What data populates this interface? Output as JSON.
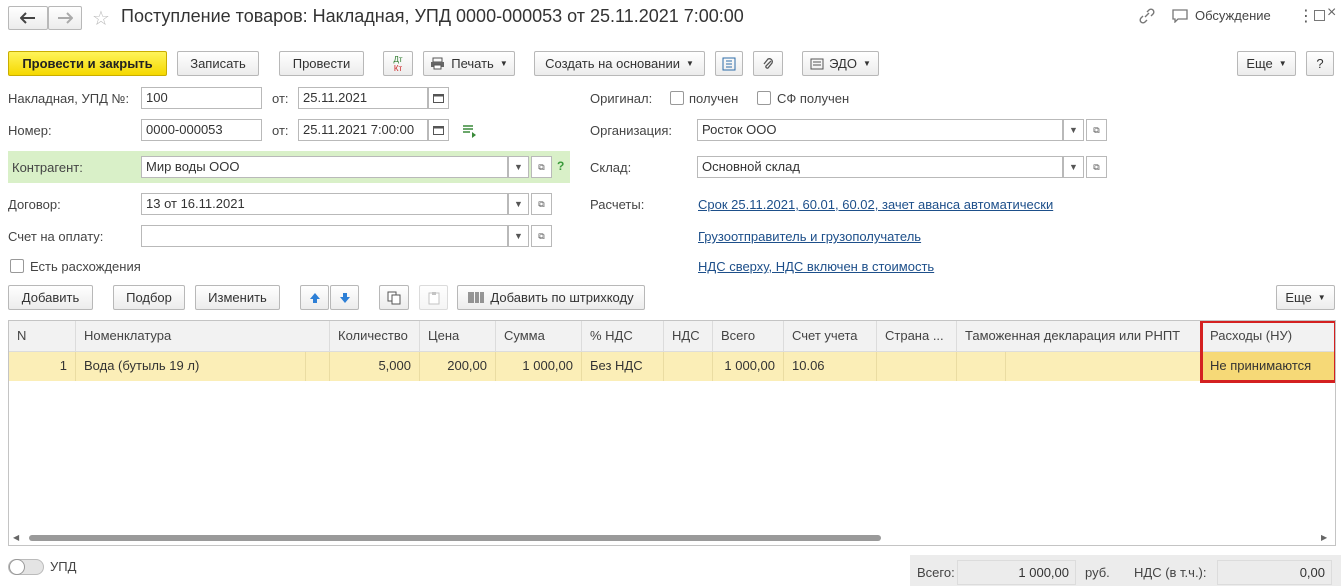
{
  "window": {
    "title": "Поступление товаров: Накладная, УПД 0000-000053 от 25.11.2021 7:00:00",
    "discussion": "Обсуждение"
  },
  "toolbar": {
    "post_close": "Провести и закрыть",
    "save": "Записать",
    "post": "Провести",
    "dtkt_top": "Дт",
    "dtkt_bottom": "Кт",
    "print": "Печать",
    "create_based": "Создать на основании",
    "edo": "ЭДО",
    "more": "Еще",
    "help": "?"
  },
  "form": {
    "invoice_label": "Накладная, УПД №:",
    "invoice_no": "100",
    "from1_label": "от:",
    "invoice_date": "25.11.2021",
    "number_label": "Номер:",
    "number": "0000-000053",
    "from2_label": "от:",
    "number_date": "25.11.2021  7:00:00",
    "counterparty_label": "Контрагент:",
    "counterparty": "Мир воды ООО",
    "contract_label": "Договор:",
    "contract": "13 от 16.11.2021",
    "payment_label": "Счет на оплату:",
    "payment": "",
    "discrepancy_label": "Есть расхождения",
    "original_label": "Оригинал:",
    "received_label": "получен",
    "sf_received_label": "СФ получен",
    "org_label": "Организация:",
    "org": "Росток ООО",
    "warehouse_label": "Склад:",
    "warehouse": "Основной склад",
    "settlements_label": "Расчеты:",
    "settlements_link": "Срок 25.11.2021, 60.01, 60.02, зачет аванса автоматически",
    "shipper_link": "Грузоотправитель и грузополучатель",
    "vat_link": "НДС сверху, НДС включен в стоимость"
  },
  "table_toolbar": {
    "add": "Добавить",
    "selection": "Подбор",
    "change": "Изменить",
    "barcode": "Добавить по штрихкоду",
    "more": "Еще"
  },
  "table": {
    "columns": [
      "N",
      "Номенклатура",
      "Количество",
      "Цена",
      "Сумма",
      "% НДС",
      "НДС",
      "Всего",
      "Счет учета",
      "Страна ...",
      "Таможенная декларация или РНПТ",
      "Расходы (НУ)"
    ],
    "rows": [
      [
        "1",
        "Вода (бутыль 19 л)",
        "5,000",
        "200,00",
        "1 000,00",
        "Без НДС",
        "",
        "1 000,00",
        "10.06",
        "",
        "",
        "Не принимаются"
      ]
    ]
  },
  "footer": {
    "upd_label": "УПД",
    "total_label": "Всего:",
    "total": "1 000,00",
    "currency": "руб.",
    "vat_label": "НДС (в т.ч.):",
    "vat": "0,00"
  },
  "colors": {
    "primary": "#f5d800",
    "highlight_row": "#fbeeb7",
    "link": "#1d4f8a",
    "alert_border": "#d42020",
    "counterparty_bg": "#d9f0c8"
  }
}
